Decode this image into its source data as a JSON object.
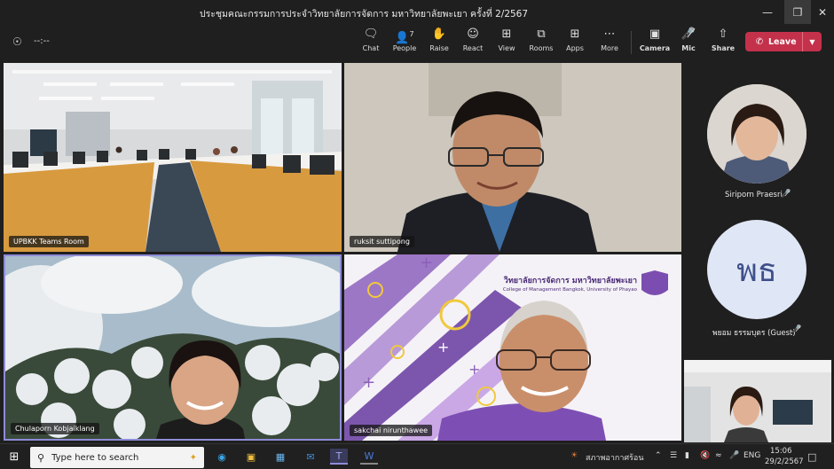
{
  "window": {
    "title": "ประชุมคณะกรรมการประจำวิทยาลัยการจัดการ มหาวิทยาลัยพะเยา ครั้งที่ 2/2567",
    "minimize_icon": "minimize-icon",
    "restore_icon": "restore-icon",
    "close_icon": "close-icon"
  },
  "toolbar": {
    "timer": "--:--",
    "chat": "Chat",
    "people": "People",
    "people_count": "7",
    "raise": "Raise",
    "react": "React",
    "view": "View",
    "rooms": "Rooms",
    "apps": "Apps",
    "more": "More",
    "camera": "Camera",
    "mic": "Mic",
    "share": "Share",
    "leave": "Leave"
  },
  "participants": {
    "tile1": "UPBKK Teams Room",
    "tile2": "ruksit suttipong",
    "tile3": "Chulaporn Kobjaiklang",
    "tile4": "sakchai nirunthawee",
    "side1": "Siriporn Praesri",
    "side2": "พยอม ธรรมบุตร (Guest)",
    "side2_initials": "พธ"
  },
  "slide": {
    "thai_line": "วิทยาลัยการจัดการ มหาวิทยาลัยพะเยา",
    "eng_line": "College of Management Bangkok, University of Phayao"
  },
  "taskbar": {
    "search_placeholder": "Type here to search",
    "weather": "สภาพอากาศร้อน",
    "lang": "ENG",
    "time": "15:06",
    "date": "29/2/2567"
  },
  "colors": {
    "leave": "#c4314b",
    "active_border": "#8e8cd8",
    "slide_purple": "#8b5fb8",
    "avatar_bg": "#dfe6f5",
    "avatar_text": "#3e4f8a"
  }
}
